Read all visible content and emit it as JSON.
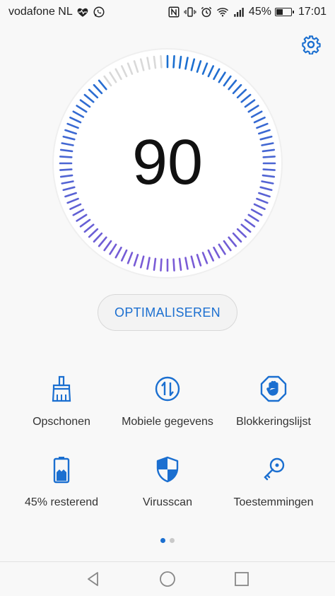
{
  "status_bar": {
    "carrier": "vodafone NL",
    "battery_percent": "45%",
    "battery_level": 0.45,
    "time": "17:01"
  },
  "header": {
    "settings_icon": "gear-icon"
  },
  "dial": {
    "score": "90",
    "score_value": 90,
    "score_max": 100,
    "gradient_start": "#1b6fd0",
    "gradient_end": "#7a5bd6"
  },
  "actions": {
    "optimize_label": "OPTIMALISEREN"
  },
  "tiles": [
    {
      "label": "Opschonen",
      "icon": "broom-icon"
    },
    {
      "label": "Mobiele gegevens",
      "icon": "data-transfer-icon"
    },
    {
      "label": "Blokkeringslijst",
      "icon": "block-hand-icon"
    },
    {
      "label": "45% resterend",
      "icon": "battery-icon"
    },
    {
      "label": "Virusscan",
      "icon": "shield-icon"
    },
    {
      "label": "Toestemmingen",
      "icon": "key-icon"
    }
  ],
  "pager": {
    "pages": 2,
    "current": 1
  },
  "colors": {
    "accent": "#1b6fd0",
    "text": "#333333",
    "background": "#f8f8f8"
  }
}
